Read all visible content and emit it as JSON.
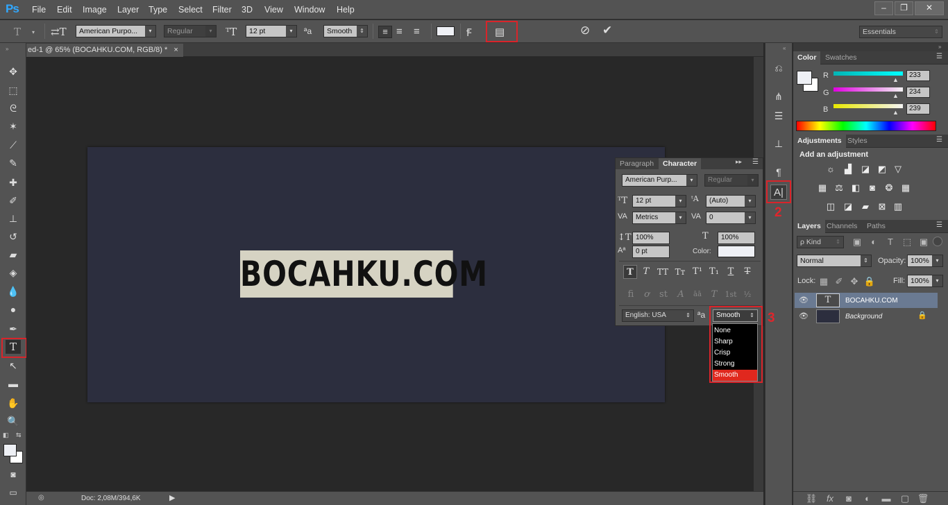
{
  "app": {
    "logo": "Ps"
  },
  "menu": [
    "File",
    "Edit",
    "Image",
    "Layer",
    "Type",
    "Select",
    "Filter",
    "3D",
    "View",
    "Window",
    "Help"
  ],
  "window_controls": [
    "–",
    "❐",
    "✕"
  ],
  "options": {
    "font_family": "American Purpo...",
    "font_style": "Regular",
    "font_size": "12 pt",
    "aa_label": "ªa",
    "aa_value": "Smooth",
    "workspace": "Essentials"
  },
  "document": {
    "tab_title": "ed-1 @ 65% (BOCAHKU.COM, RGB/8) *",
    "tab_close": "×",
    "text": "BOCAHKU.COM",
    "status": "Doc: 2,08M/394,6K"
  },
  "annotations": [
    "1",
    "2",
    "2",
    "3"
  ],
  "color_panel": {
    "tabs": [
      "Color",
      "Swatches"
    ],
    "channels": [
      {
        "label": "R",
        "value": "233",
        "color": "#00e5ff"
      },
      {
        "label": "G",
        "value": "234",
        "color": "#ff3de6"
      },
      {
        "label": "B",
        "value": "239",
        "color": "#f2f200"
      }
    ]
  },
  "adjustments_panel": {
    "tabs": [
      "Adjustments",
      "Styles"
    ],
    "title": "Add an adjustment"
  },
  "character_panel": {
    "tabs": [
      "Paragraph",
      "Character"
    ],
    "font_family": "American Purp...",
    "font_style": "Regular",
    "size": "12 pt",
    "leading": "(Auto)",
    "kerning": "Metrics",
    "tracking": "0",
    "vscale": "100%",
    "hscale": "100%",
    "baseline": "0 pt",
    "color_label": "Color:",
    "language": "English: USA",
    "aa_label": "ªa",
    "aa_value": "Smooth",
    "aa_options": [
      "None",
      "Sharp",
      "Crisp",
      "Strong",
      "Smooth"
    ]
  },
  "layers_panel": {
    "tabs": [
      "Layers",
      "Channels",
      "Paths"
    ],
    "filter": "ρ Kind",
    "blend_mode": "Normal",
    "opacity_label": "Opacity:",
    "opacity": "100%",
    "lock_label": "Lock:",
    "fill_label": "Fill:",
    "fill": "100%",
    "layers": [
      {
        "name": "BOCAHKU.COM",
        "thumb": "T"
      },
      {
        "name": "Background"
      }
    ]
  }
}
